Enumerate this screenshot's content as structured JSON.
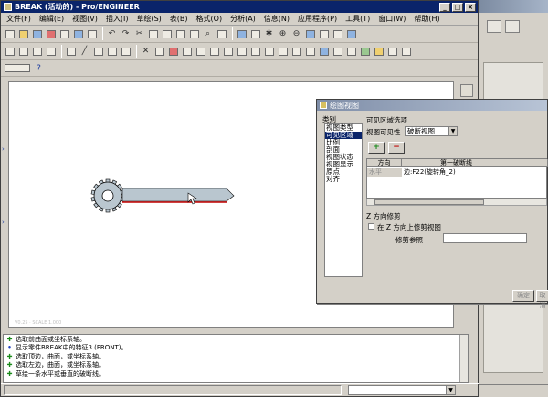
{
  "window": {
    "title": "BREAK (活动的) - Pro/ENGINEER",
    "min_label": "_",
    "max_label": "□",
    "close_label": "×"
  },
  "menu": [
    "文件(F)",
    "编辑(E)",
    "视图(V)",
    "插入(I)",
    "草绘(S)",
    "表(B)",
    "格式(O)",
    "分析(A)",
    "信息(N)",
    "应用程序(P)",
    "工具(T)",
    "窗口(W)",
    "帮助(H)"
  ],
  "messages": [
    {
      "icon": "check",
      "text": "选取前曲面或坐标系轴。"
    },
    {
      "icon": "info",
      "text": "显示零件BREAK中的特征3 (FRONT)。"
    },
    {
      "icon": "check",
      "text": "选取顶边，曲面，或坐标系轴。"
    },
    {
      "icon": "check",
      "text": "选取左边，曲面，或坐标系轴。"
    },
    {
      "icon": "check",
      "text": "草绘一条水平或垂直的破断线。"
    }
  ],
  "drawing": {
    "hint": "V0.25 · SCALE 1.000"
  },
  "dialog": {
    "title": "绘图视图",
    "category_label": "类别",
    "categories": [
      "视图类型",
      "可见区域",
      "比例",
      "剖面",
      "视图状态",
      "视图显示",
      "原点",
      "对齐"
    ],
    "selected_category": 1,
    "group_title": "可见区域选项",
    "visibility_label": "视图可见性",
    "visibility_value": "破断视图",
    "add_label": "+",
    "remove_label": "−",
    "table": {
      "col_direction": "方向",
      "col_first_line": "第一破断线",
      "row_direction": "水平",
      "row_first_line": "边:F22(旋转角_2)"
    },
    "z_clip_title": "Z 方向修剪",
    "z_clip_check_label": "在 Z 方向上修剪视图",
    "clip_ref_label": "修剪参照",
    "apply_label": "确定",
    "cancel_label": "取消"
  },
  "colors": {
    "title_active": "#0a246a",
    "break_line": "#c00000",
    "part_fill": "#b9c6cf"
  }
}
